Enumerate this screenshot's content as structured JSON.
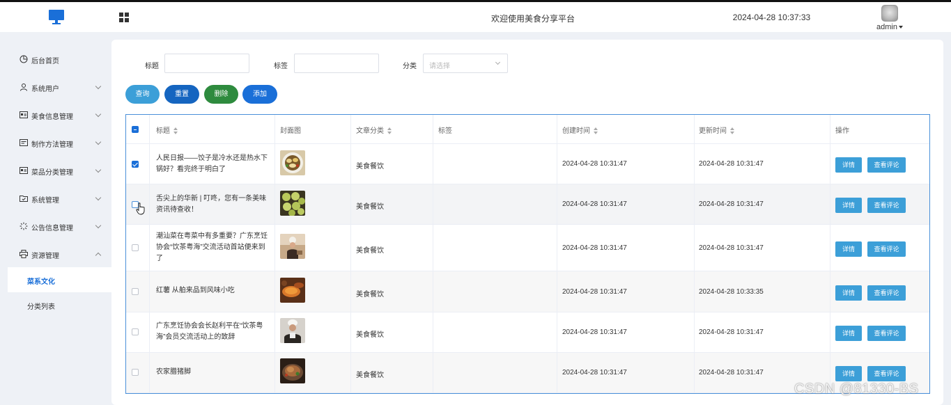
{
  "header": {
    "title": "欢迎使用美食分享平台",
    "datetime": "2024-04-28 10:37:33",
    "user": "admin"
  },
  "sidebar": {
    "items": [
      {
        "label": "后台首页",
        "icon": "pie-chart-icon",
        "has_arrow": false
      },
      {
        "label": "系统用户",
        "icon": "user-icon",
        "has_arrow": true
      },
      {
        "label": "美食信息管理",
        "icon": "id-card-icon",
        "has_arrow": true
      },
      {
        "label": "制作方法管理",
        "icon": "edit-box-icon",
        "has_arrow": true
      },
      {
        "label": "菜品分类管理",
        "icon": "id-card-icon",
        "has_arrow": true
      },
      {
        "label": "系统管理",
        "icon": "checkbox-folder-icon",
        "has_arrow": true
      },
      {
        "label": "公告信息管理",
        "icon": "loading-icon",
        "has_arrow": true
      },
      {
        "label": "资源管理",
        "icon": "printer-icon",
        "has_arrow": true,
        "expanded": true
      }
    ],
    "subitems": [
      {
        "label": "菜系文化",
        "active": true
      },
      {
        "label": "分类列表",
        "active": false
      }
    ]
  },
  "filters": {
    "title_label": "标题",
    "title_value": "",
    "tag_label": "标签",
    "tag_value": "",
    "category_label": "分类",
    "category_placeholder": "请选择"
  },
  "buttons": {
    "query": "查询",
    "reset": "重置",
    "delete": "删除",
    "add": "添加"
  },
  "colors": {
    "query": "#3c9fd8",
    "reset": "#1565c0",
    "delete": "#2e8b3e",
    "add": "#1a6fd8"
  },
  "table": {
    "headers": {
      "title": "标题",
      "cover": "封面图",
      "category": "文章分类",
      "tags": "标签",
      "created": "创建时间",
      "updated": "更新时间",
      "actions": "操作"
    },
    "detail_label": "详情",
    "comments_label": "查看评论",
    "rows": [
      {
        "title": "人民日报——饺子是冷水还是热水下锅好？看完终于明白了",
        "category": "美食餐饮",
        "tags": "",
        "created": "2024-04-28 10:31:47",
        "updated": "2024-04-28 10:31:47",
        "checked": true,
        "thumb": "dumplings"
      },
      {
        "title": "舌尖上的华新 | 叮咚，您有一条美味资讯待查收！",
        "category": "美食餐饮",
        "tags": "",
        "created": "2024-04-28 10:31:47",
        "updated": "2024-04-28 10:31:47",
        "checked": false,
        "thumb": "green-balls"
      },
      {
        "title": "潮汕菜在粤菜中有多重要？广东烹饪协会“饮茶粤海”交流活动首站便来到了",
        "category": "美食餐饮",
        "tags": "",
        "created": "2024-04-28 10:31:47",
        "updated": "2024-04-28 10:31:47",
        "checked": false,
        "thumb": "chef"
      },
      {
        "title": "红薯 从舶来品到风味小吃",
        "category": "美食餐饮",
        "tags": "",
        "created": "2024-04-28 10:31:47",
        "updated": "2024-04-28 10:33:35",
        "checked": false,
        "thumb": "sweet-potato"
      },
      {
        "title": "广东烹饪协会会长赵利平在“饮茶粤海”会员交流活动上的致辞",
        "category": "美食餐饮",
        "tags": "",
        "created": "2024-04-28 10:31:47",
        "updated": "2024-04-28 10:31:47",
        "checked": false,
        "thumb": "portrait"
      },
      {
        "title": "农家腊猪脚",
        "category": "美食餐饮",
        "tags": "",
        "created": "2024-04-28 10:31:47",
        "updated": "2024-04-28 10:31:47",
        "checked": false,
        "thumb": "pork"
      }
    ]
  },
  "watermark": "CSDN @81330-BS"
}
